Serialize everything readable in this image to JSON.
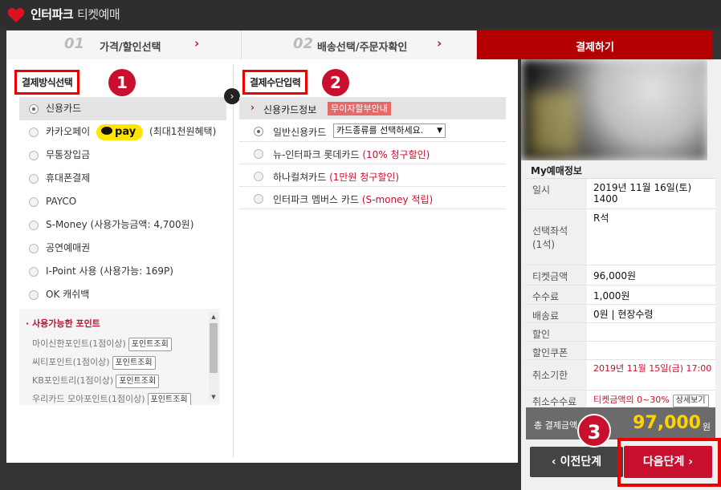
{
  "header": {
    "app_title": "인터파크",
    "app_subtitle": "티켓예매"
  },
  "steps": [
    {
      "num": "01",
      "label": "가격/할인선택"
    },
    {
      "num": "02",
      "label": "배송선택/주문자확인"
    },
    {
      "label": "결제하기"
    }
  ],
  "left": {
    "section_title": "결제방식선택",
    "badge": "1",
    "methods": [
      {
        "label": "신용카드"
      },
      {
        "label_pre": "카카오페이",
        "kpay": "pay",
        "label_post": "(최대1천원혜택)"
      },
      {
        "label": "무통장입금"
      },
      {
        "label": "휴대폰결제"
      },
      {
        "label": "PAYCO"
      },
      {
        "label": "S-Money (사용가능금액: 4,700원)"
      },
      {
        "label": "공연예매권"
      },
      {
        "label": "I-Point 사용 (사용가능: 169P)"
      },
      {
        "label": "OK 캐쉬백"
      }
    ],
    "points": {
      "title": "사용가능한 포인트",
      "button": "포인트조회",
      "rows": [
        "마이신한포인트(1점이상)",
        "씨티포인트(1점이상)",
        "KB포인트리(1점이상)",
        "우리카드 모아포인트(1점이상)"
      ]
    }
  },
  "middle": {
    "section_title": "결제수단입력",
    "badge": "2",
    "card_header": "신용카드정보",
    "card_tag": "무이자할부안내",
    "cards": [
      {
        "label": "일반신용카드",
        "select": "카드종류를 선택하세요."
      },
      {
        "label": "뉴-인터파크 롯데카드 ",
        "note": "(10% 청구할인)"
      },
      {
        "label": "하나컬쳐카드 ",
        "note": "(1만원 청구할인)"
      },
      {
        "label": "인터파크 멤버스 카드 ",
        "note": "(S-money 적립)"
      }
    ]
  },
  "right": {
    "my_title": "My예매정보",
    "rows": {
      "date_k": "일시",
      "date_v": "2019년 11월 16일(토) 1400",
      "seat_k": "선택좌석\n(1석)",
      "seat_v": "R석",
      "price_k": "티켓금액",
      "price_v": "96,000원",
      "fee_k": "수수료",
      "fee_v": "1,000원",
      "ship_k": "배송료",
      "ship_v": "0원 | 현장수령",
      "disc_k": "할인",
      "disc_v": "",
      "coupon_k": "할인쿠폰",
      "coupon_v": "",
      "cancel_k": "취소기한",
      "cancel_v": "2019년 11월 15일(금) 17:00",
      "cfee_k": "취소수수료",
      "cfee_v": "티켓금액의 0~30%",
      "cfee_btn": "상세보기"
    },
    "total_k": "총 결제금액",
    "total_v": "97,000",
    "total_u": "원",
    "prev": "이전단계",
    "next": "다음단계",
    "badge": "3"
  },
  "colors": {
    "accent": "#c8102e",
    "highlight": "#ee0000",
    "kakao": "#ffe500"
  }
}
